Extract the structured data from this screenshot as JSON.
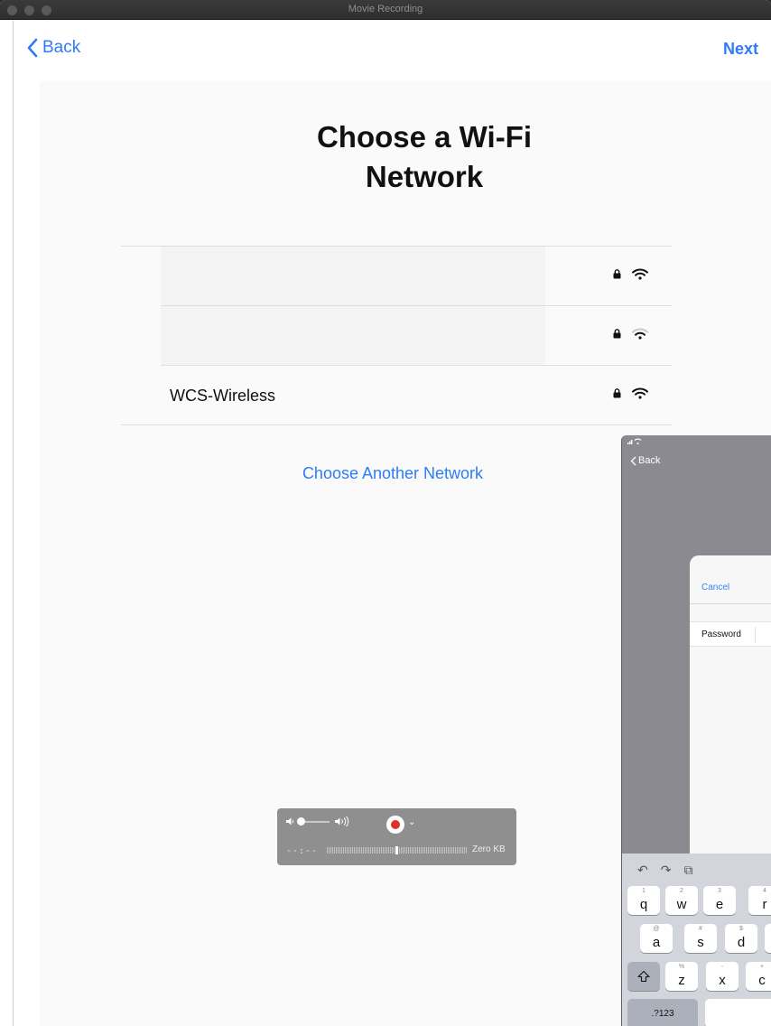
{
  "window": {
    "title": "Movie Recording"
  },
  "nav": {
    "back_label": "Back",
    "next_label": "Next"
  },
  "page": {
    "heading_line1": "Choose a Wi-Fi",
    "heading_line2": "Network",
    "choose_another_label": "Choose Another Network"
  },
  "networks": [
    {
      "name": "",
      "locked": true,
      "signal": "full"
    },
    {
      "name": "",
      "locked": true,
      "signal": "medium"
    },
    {
      "name": "WCS-Wireless",
      "locked": true,
      "signal": "full"
    }
  ],
  "recorder": {
    "time": "--:--",
    "size": "Zero KB",
    "record_color": "#e0302c",
    "volume": 0.0
  },
  "ipad_preview": {
    "back_label": "Back",
    "cancel_label": "Cancel",
    "password_label": "Password",
    "keyboard": {
      "row1": [
        {
          "sub": "1",
          "main": "q"
        },
        {
          "sub": "2",
          "main": "w"
        },
        {
          "sub": "3",
          "main": "e"
        },
        {
          "sub": "4",
          "main": "r"
        }
      ],
      "row2": [
        {
          "sub": "@",
          "main": "a"
        },
        {
          "sub": "#",
          "main": "s"
        },
        {
          "sub": "$",
          "main": "d"
        }
      ],
      "row3": [
        {
          "sub": "%",
          "main": "z"
        },
        {
          "sub": "-",
          "main": "x"
        },
        {
          "sub": "+",
          "main": "c"
        }
      ],
      "numbers_key": ".?123"
    }
  },
  "colors": {
    "accent": "#2e7cf6",
    "heading": "#111111"
  }
}
